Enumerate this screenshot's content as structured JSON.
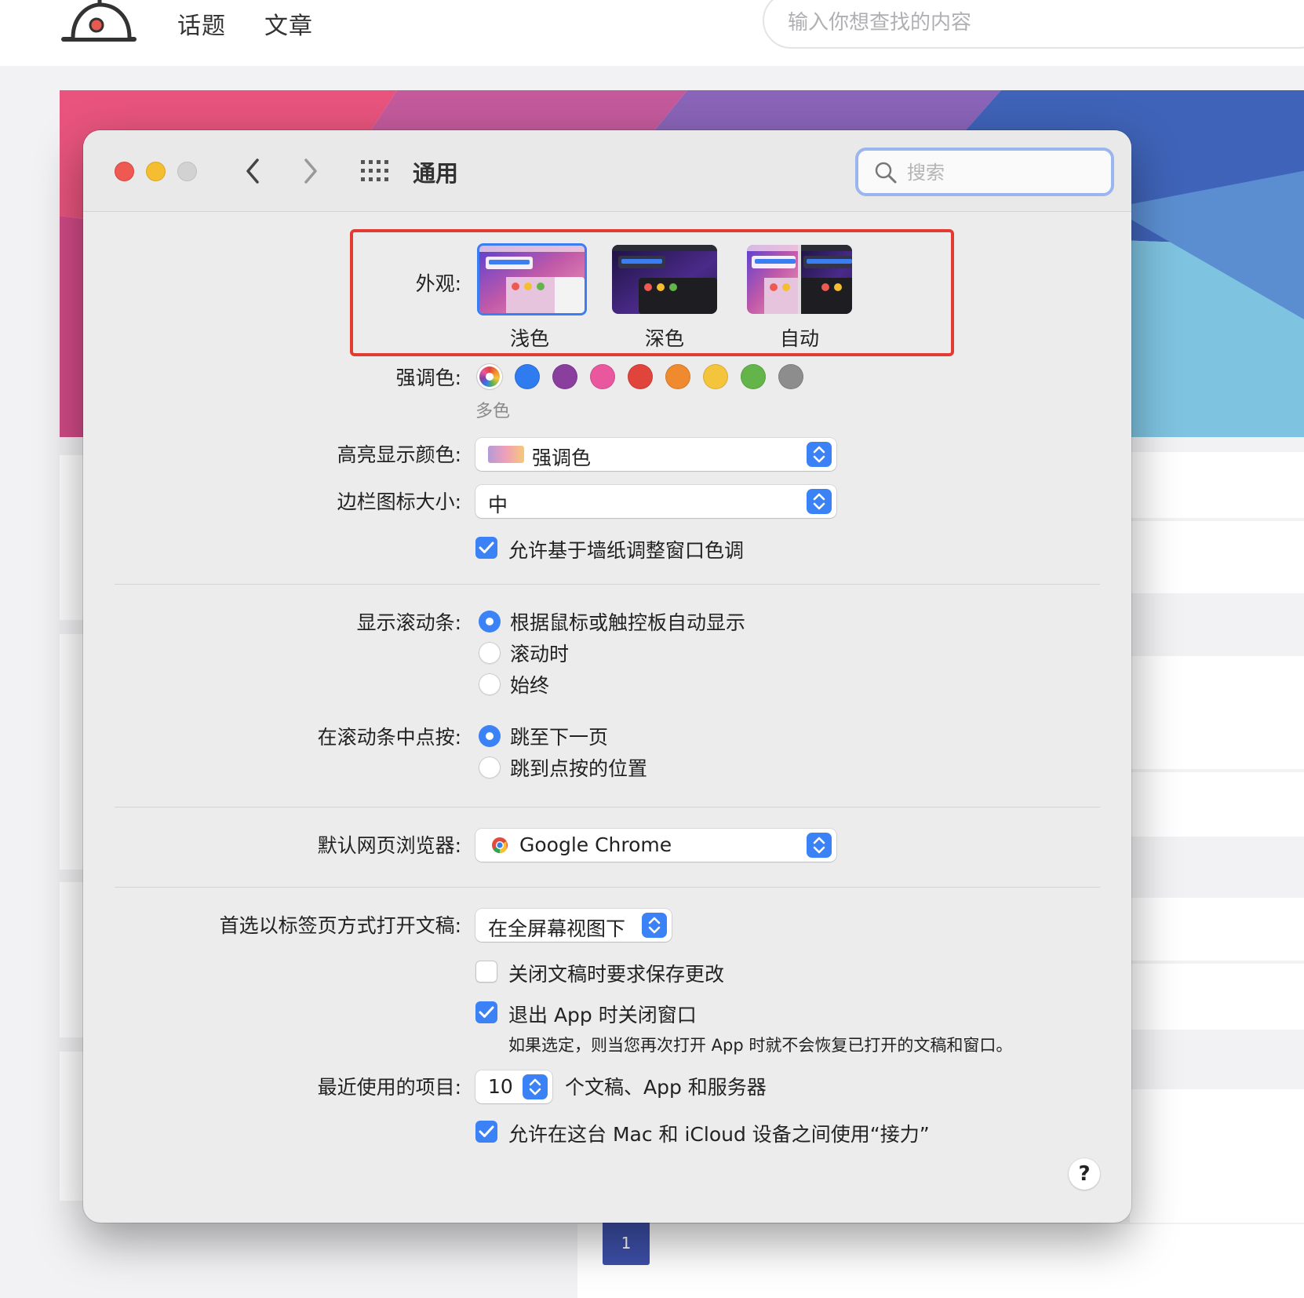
{
  "site": {
    "nav": [
      "话题",
      "文章"
    ],
    "search_placeholder": "输入你想查找的内容",
    "page_number": "1"
  },
  "window": {
    "title": "通用",
    "search_placeholder": "搜索"
  },
  "appearance": {
    "label": "外观:",
    "options": [
      "浅色",
      "深色",
      "自动"
    ],
    "selected": "浅色"
  },
  "accent": {
    "label": "强调色:",
    "colors": [
      "multicolor",
      "#2f7bf0",
      "#8a3f9e",
      "#e9589f",
      "#e0443b",
      "#ef8a2f",
      "#f5c43d",
      "#63b54a",
      "#8d8d8d"
    ],
    "selected_caption": "多色"
  },
  "highlight": {
    "label": "高亮显示颜色:",
    "value": "强调色"
  },
  "sidebar_icon_size": {
    "label": "边栏图标大小:",
    "value": "中"
  },
  "wallpaper_tint": {
    "label": "允许基于墙纸调整窗口色调",
    "checked": true
  },
  "show_scrollbars": {
    "label": "显示滚动条:",
    "options": [
      "根据鼠标或触控板自动显示",
      "滚动时",
      "始终"
    ],
    "selected_index": 0
  },
  "click_scrollbar": {
    "label": "在滚动条中点按:",
    "options": [
      "跳至下一页",
      "跳到点按的位置"
    ],
    "selected_index": 0
  },
  "default_browser": {
    "label": "默认网页浏览器:",
    "value": "Google Chrome"
  },
  "prefer_tabs": {
    "label": "首选以标签页方式打开文稿:",
    "value": "在全屏幕视图下"
  },
  "ask_keep_changes": {
    "label": "关闭文稿时要求保存更改",
    "checked": false
  },
  "close_windows": {
    "label": "退出 App 时关闭窗口",
    "checked": true,
    "note": "如果选定，则当您再次打开 App 时就不会恢复已打开的文稿和窗口。"
  },
  "recent_items": {
    "label": "最近使用的项目:",
    "value": "10",
    "suffix": "个文稿、App 和服务器"
  },
  "handoff": {
    "label": "允许在这台 Mac 和 iCloud 设备之间使用“接力”",
    "checked": true
  },
  "help_label": "?"
}
